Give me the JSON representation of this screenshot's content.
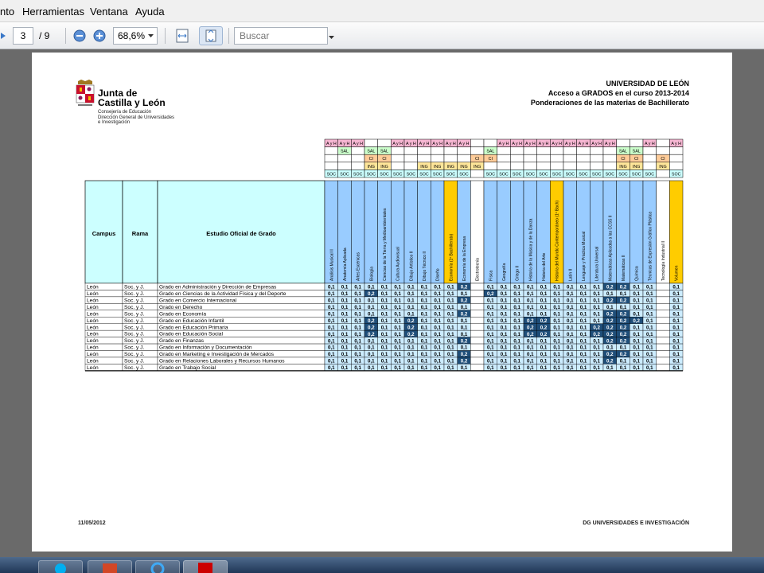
{
  "menu": {
    "items": [
      "nto",
      "Herramientas",
      "Ventana",
      "Ayuda"
    ]
  },
  "toolbar": {
    "page_current": "3",
    "page_total": "/ 9",
    "zoom": "68,6%",
    "search_placeholder": "Buscar"
  },
  "document": {
    "logo": {
      "line1": "Junta de",
      "line2": "Castilla y León",
      "sub1": "Consejería de Educación",
      "sub2": "Dirección General de Universidades",
      "sub3": "e Investigación"
    },
    "title1": "UNIVERSIDAD DE LEÓN",
    "title2": "Acceso a GRADOS en el curso 2013-2014",
    "title3": "Ponderaciones de las materias de Bachillerato",
    "table": {
      "col_campus": "Campus",
      "col_rama": "Rama",
      "col_estudio": "Estudio Oficial de Grado",
      "subjects": [
        "Análisis Musical II",
        "Anatomía Aplicada",
        "Artes Escénicas",
        "Biología",
        "Ciencias de la Tierra y Medioambientales",
        "Cultura Audiovisual",
        "Dibujo Artístico II",
        "Dibujo Técnico II",
        "Diseño",
        "Economía (1º Bachillerato)",
        "Economía de la Empresa",
        "Electrotecnia",
        "Física",
        "Geografía",
        "Griego II",
        "Historia de la Música y de la Danza",
        "Historia del Arte",
        "Historia del Mundo Contemporáneo (1º Bach)",
        "Latín II",
        "Lenguaje y Práctica Musical",
        "Literatura Universal",
        "Matemáticas Aplicadas a las CCSS II",
        "Matemáticas II",
        "Química",
        "Técnicas de Expresión Gráfico Plástica",
        "Tecnología Industrial II",
        "Volumen"
      ],
      "tags": [
        [
          "A y H",
          "A y H",
          "A y H",
          "",
          "",
          "A y H",
          "A y H",
          "A y H",
          "A y H",
          "A y H",
          "A y H",
          "",
          "",
          "A y H",
          "A y H",
          "A y H",
          "A y H",
          "A y H",
          "A y H",
          "A y H",
          "A y H",
          "A y H",
          "",
          "",
          "A y H",
          "",
          "A y H"
        ],
        [
          "",
          "SAL",
          "",
          "SAL",
          "SAL",
          "",
          "",
          "",
          "",
          "",
          "",
          "",
          "SAL",
          "",
          "",
          "",
          "",
          "",
          "",
          "",
          "",
          "",
          "SAL",
          "SAL",
          "",
          "",
          ""
        ],
        [
          "",
          "",
          "",
          "CI",
          "CI",
          "",
          "",
          "",
          "",
          "",
          "",
          "CI",
          "CI",
          "",
          "",
          "",
          "",
          "",
          "",
          "",
          "",
          "",
          "CI",
          "CI",
          "",
          "CI",
          ""
        ],
        [
          "",
          "",
          "",
          "ING",
          "ING",
          "",
          "",
          "ING",
          "ING",
          "ING",
          "ING",
          "ING",
          "",
          "",
          "",
          "",
          "",
          "",
          "",
          "",
          "",
          "",
          "ING",
          "ING",
          "",
          "ING",
          ""
        ],
        [
          "SOC",
          "SOC",
          "SOC",
          "SOC",
          "SOC",
          "SOC",
          "SOC",
          "SOC",
          "SOC",
          "SOC",
          "SOC",
          "",
          "SOC",
          "SOC",
          "SOC",
          "SOC",
          "SOC",
          "SOC",
          "SOC",
          "SOC",
          "SOC",
          "SOC",
          "SOC",
          "SOC",
          "SOC",
          "",
          "SOC"
        ]
      ],
      "rows": [
        {
          "campus": "León",
          "rama": "Soc. y J.",
          "estudio": "Grado en Administración y Dirección de Empresas",
          "vals": [
            "0,1",
            "0,1",
            "0,1",
            "0,1",
            "0,1",
            "0,1",
            "0,1",
            "0,1",
            "0,1",
            "0,1",
            "0,2",
            "",
            "0,1",
            "0,1",
            "0,1",
            "0,1",
            "0,1",
            "0,1",
            "0,1",
            "0,1",
            "0,1",
            "0,2",
            "0,2",
            "0,1",
            "0,1",
            "",
            "0,1"
          ]
        },
        {
          "campus": "León",
          "rama": "Soc. y J.",
          "estudio": "Grado en Ciencias de la Actividad Física y del Deporte",
          "vals": [
            "0,1",
            "0,1",
            "0,1",
            "0,2",
            "0,1",
            "0,1",
            "0,1",
            "0,1",
            "0,1",
            "0,1",
            "0,1",
            "",
            "0,2",
            "0,1",
            "0,1",
            "0,1",
            "0,1",
            "0,1",
            "0,1",
            "0,1",
            "0,1",
            "0,1",
            "0,1",
            "0,1",
            "0,1",
            "",
            "0,1"
          ]
        },
        {
          "campus": "León",
          "rama": "Soc. y J.",
          "estudio": "Grado en Comercio Internacional",
          "vals": [
            "0,1",
            "0,1",
            "0,1",
            "0,1",
            "0,1",
            "0,1",
            "0,1",
            "0,1",
            "0,1",
            "0,1",
            "0,2",
            "",
            "0,1",
            "0,1",
            "0,1",
            "0,1",
            "0,1",
            "0,1",
            "0,1",
            "0,1",
            "0,1",
            "0,2",
            "0,2",
            "0,1",
            "0,1",
            "",
            "0,1"
          ]
        },
        {
          "campus": "León",
          "rama": "Soc. y J.",
          "estudio": "Grado en Derecho",
          "vals": [
            "0,1",
            "0,1",
            "0,1",
            "0,1",
            "0,1",
            "0,1",
            "0,1",
            "0,1",
            "0,1",
            "0,1",
            "0,1",
            "",
            "0,1",
            "0,1",
            "0,1",
            "0,1",
            "0,1",
            "0,1",
            "0,1",
            "0,1",
            "0,1",
            "0,1",
            "0,1",
            "0,1",
            "0,1",
            "",
            "0,1"
          ]
        },
        {
          "campus": "León",
          "rama": "Soc. y J.",
          "estudio": "Grado en Economía",
          "vals": [
            "0,1",
            "0,1",
            "0,1",
            "0,1",
            "0,1",
            "0,1",
            "0,1",
            "0,1",
            "0,1",
            "0,1",
            "0,2",
            "",
            "0,1",
            "0,1",
            "0,1",
            "0,1",
            "0,1",
            "0,1",
            "0,1",
            "0,1",
            "0,1",
            "0,2",
            "0,2",
            "0,1",
            "0,1",
            "",
            "0,1"
          ]
        },
        {
          "campus": "León",
          "rama": "Soc. y J.",
          "estudio": "Grado en Educación Infantil",
          "vals": [
            "0,1",
            "0,1",
            "0,1",
            "0,2",
            "0,1",
            "0,1",
            "0,2",
            "0,1",
            "0,1",
            "0,1",
            "0,1",
            "",
            "0,1",
            "0,1",
            "0,1",
            "0,2",
            "0,2",
            "0,1",
            "0,1",
            "0,1",
            "0,1",
            "0,2",
            "0,2",
            "0,2",
            "0,1",
            "",
            "0,1"
          ]
        },
        {
          "campus": "León",
          "rama": "Soc. y J.",
          "estudio": "Grado en Educación Primaria",
          "vals": [
            "0,1",
            "0,1",
            "0,1",
            "0,2",
            "0,1",
            "0,1",
            "0,2",
            "0,1",
            "0,1",
            "0,1",
            "0,1",
            "",
            "0,1",
            "0,1",
            "0,1",
            "0,2",
            "0,2",
            "0,1",
            "0,1",
            "0,1",
            "0,2",
            "0,2",
            "0,2",
            "0,1",
            "0,1",
            "",
            "0,1"
          ]
        },
        {
          "campus": "León",
          "rama": "Soc. y J.",
          "estudio": "Grado en Educación Social",
          "vals": [
            "0,1",
            "0,1",
            "0,1",
            "0,2",
            "0,1",
            "0,1",
            "0,2",
            "0,1",
            "0,1",
            "0,1",
            "0,1",
            "",
            "0,1",
            "0,1",
            "0,1",
            "0,2",
            "0,2",
            "0,1",
            "0,1",
            "0,1",
            "0,2",
            "0,2",
            "0,2",
            "0,1",
            "0,1",
            "",
            "0,1"
          ]
        },
        {
          "campus": "León",
          "rama": "Soc. y J.",
          "estudio": "Grado en Finanzas",
          "vals": [
            "0,1",
            "0,1",
            "0,1",
            "0,1",
            "0,1",
            "0,1",
            "0,1",
            "0,1",
            "0,1",
            "0,1",
            "0,2",
            "",
            "0,1",
            "0,1",
            "0,1",
            "0,1",
            "0,1",
            "0,1",
            "0,1",
            "0,1",
            "0,1",
            "0,2",
            "0,2",
            "0,1",
            "0,1",
            "",
            "0,1"
          ]
        },
        {
          "campus": "León",
          "rama": "Soc. y J.",
          "estudio": "Grado en Información y Documentación",
          "vals": [
            "0,1",
            "0,1",
            "0,1",
            "0,1",
            "0,1",
            "0,1",
            "0,1",
            "0,1",
            "0,1",
            "0,1",
            "0,1",
            "",
            "0,1",
            "0,1",
            "0,1",
            "0,1",
            "0,1",
            "0,1",
            "0,1",
            "0,1",
            "0,1",
            "0,1",
            "0,1",
            "0,1",
            "0,1",
            "",
            "0,1"
          ]
        },
        {
          "campus": "León",
          "rama": "Soc. y J.",
          "estudio": "Grado en Marketing e Investigación de Mercados",
          "vals": [
            "0,1",
            "0,1",
            "0,1",
            "0,1",
            "0,1",
            "0,1",
            "0,1",
            "0,1",
            "0,1",
            "0,1",
            "0,2",
            "",
            "0,1",
            "0,1",
            "0,1",
            "0,1",
            "0,1",
            "0,1",
            "0,1",
            "0,1",
            "0,1",
            "0,2",
            "0,2",
            "0,1",
            "0,1",
            "",
            "0,1"
          ]
        },
        {
          "campus": "León",
          "rama": "Soc. y J.",
          "estudio": "Grado en Relaciones Laborales y Recursos Humanos",
          "vals": [
            "0,1",
            "0,1",
            "0,1",
            "0,1",
            "0,1",
            "0,1",
            "0,1",
            "0,1",
            "0,1",
            "0,1",
            "0,2",
            "",
            "0,1",
            "0,1",
            "0,1",
            "0,1",
            "0,1",
            "0,1",
            "0,1",
            "0,1",
            "0,1",
            "0,2",
            "0,1",
            "0,1",
            "0,1",
            "",
            "0,1"
          ]
        },
        {
          "campus": "León",
          "rama": "Soc. y J.",
          "estudio": "Grado en Trabajo Social",
          "vals": [
            "0,1",
            "0,1",
            "0,1",
            "0,1",
            "0,1",
            "0,1",
            "0,1",
            "0,1",
            "0,1",
            "0,1",
            "0,1",
            "",
            "0,1",
            "0,1",
            "0,1",
            "0,1",
            "0,1",
            "0,1",
            "0,1",
            "0,1",
            "0,1",
            "0,1",
            "0,1",
            "0,1",
            "0,1",
            "",
            "0,1"
          ]
        }
      ]
    },
    "footer_date": "11/05/2012",
    "footer_org": "DG UNIVERSIDADES  E INVESTIGACIÓN"
  },
  "colors": {
    "tag_ayh": "#f7b6d2",
    "tag_sal": "#ccffcc",
    "tag_ci": "#ffcc99",
    "tag_ing": "#ffe699",
    "tag_soc": "#ccffff",
    "subject_blue": "#99ccff",
    "subject_yellow": "#ffcc00",
    "cell": "#ccecff",
    "cell_high": "#1f4e79"
  }
}
